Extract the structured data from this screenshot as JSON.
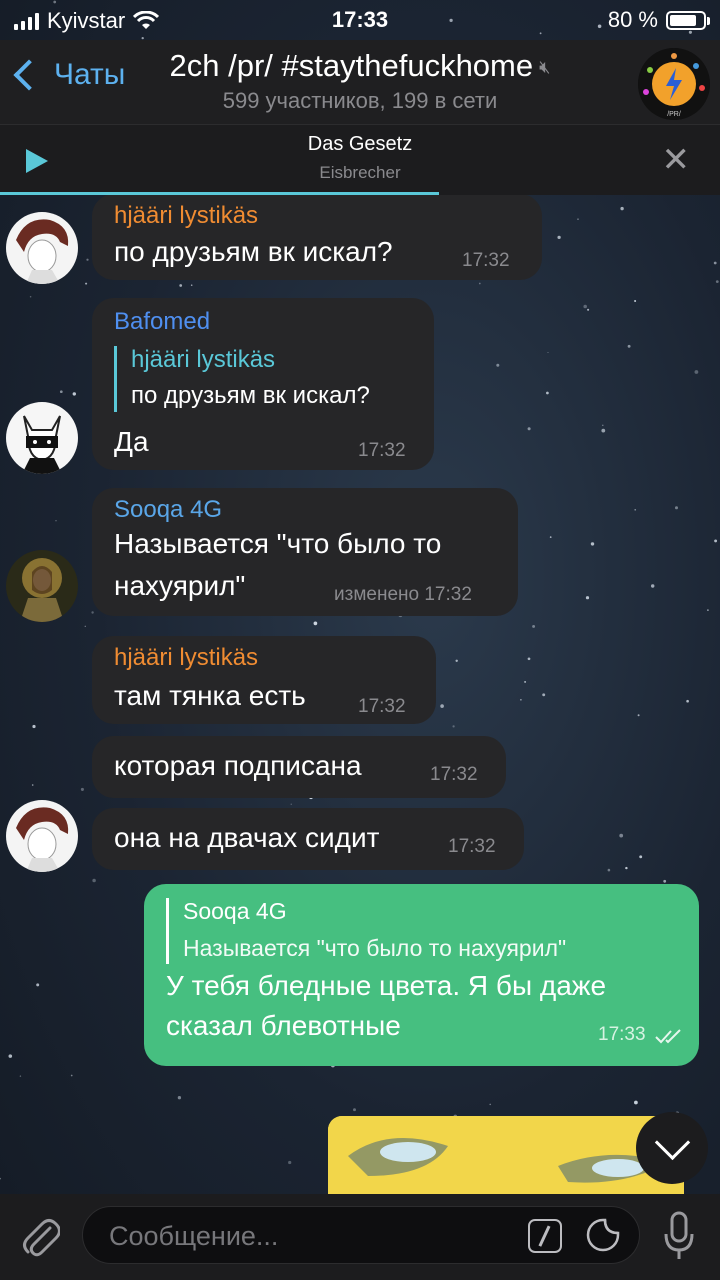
{
  "status_bar": {
    "carrier": "Kyivstar",
    "time": "17:33",
    "battery": "80 %",
    "battery_level": 0.8
  },
  "header": {
    "back_label": "Чаты",
    "title": "2ch /pr/ #staythefuckhome",
    "subtitle": "599 участников, 199 в сети",
    "avatar_label": "/PR/"
  },
  "music": {
    "song": "Das Gesetz",
    "artist": "Eisbrecher",
    "progress": 0.61
  },
  "messages": [
    {
      "sender": "hjääri lystikäs",
      "text": "по друзьям вк искал?",
      "time": "17:32"
    },
    {
      "sender": "Bafomed",
      "reply_to": "hjääri lystikäs",
      "reply_text": "по друзьям вк искал?",
      "text": "Да",
      "time": "17:32"
    },
    {
      "sender": "Sooqa 4G",
      "text_line1": "Называется \"что было то",
      "text_line2": "нахуярил\"",
      "time": "изменено 17:32"
    },
    {
      "sender": "hjääri lystikäs",
      "text": "там тянка есть",
      "time": "17:32"
    },
    {
      "text": "которая подписана",
      "time": "17:32"
    },
    {
      "text": "она на двачах сидит",
      "time": "17:32"
    },
    {
      "reply_to": "Sooqa 4G",
      "reply_text": "Называется \"что было то нахуярил\"",
      "text_line1": "У тебя бледные цвета. Я бы даже",
      "text_line2": "сказал блевотные",
      "time": "17:33"
    }
  ],
  "colors": {
    "accent": "#5db1ef",
    "name_orange": "#f08c32",
    "name_blue": "#4f8ff0",
    "name_lightblue": "#5aa6e8",
    "outgoing": "#46bf80",
    "quote_cyan": "#5ac8d8"
  },
  "input": {
    "placeholder": "Сообщение..."
  }
}
